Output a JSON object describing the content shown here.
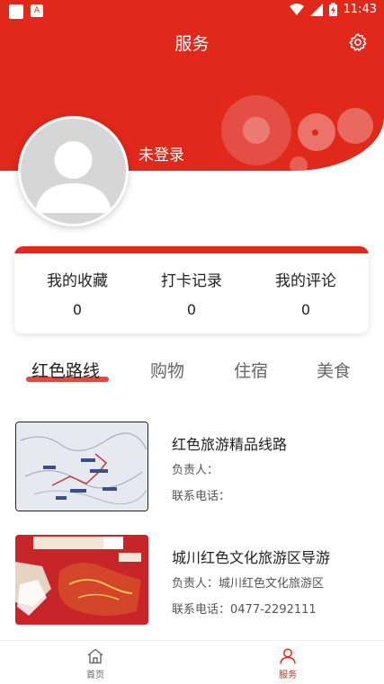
{
  "status_bar": {
    "time": "11:43"
  },
  "header": {
    "title": "服务",
    "login_text": "未登录"
  },
  "stats": [
    {
      "label": "我的收藏",
      "value": "0"
    },
    {
      "label": "打卡记录",
      "value": "0"
    },
    {
      "label": "我的评论",
      "value": "0"
    }
  ],
  "tabs": [
    {
      "label": "红色路线"
    },
    {
      "label": "购物"
    },
    {
      "label": "住宿"
    },
    {
      "label": "美食"
    }
  ],
  "items": [
    {
      "title": "红色旅游精品线路",
      "contact_label": "负责人：",
      "phone_label": "联系电话："
    },
    {
      "title": "城川红色文化旅游区导游",
      "contact_label": "负责人：城川红色文化旅游区",
      "phone_label": "联系电话：0477-2292111"
    }
  ],
  "tabbar": {
    "home_label": "首页",
    "service_label": "服务"
  },
  "colors": {
    "primary": "#e0281b"
  }
}
